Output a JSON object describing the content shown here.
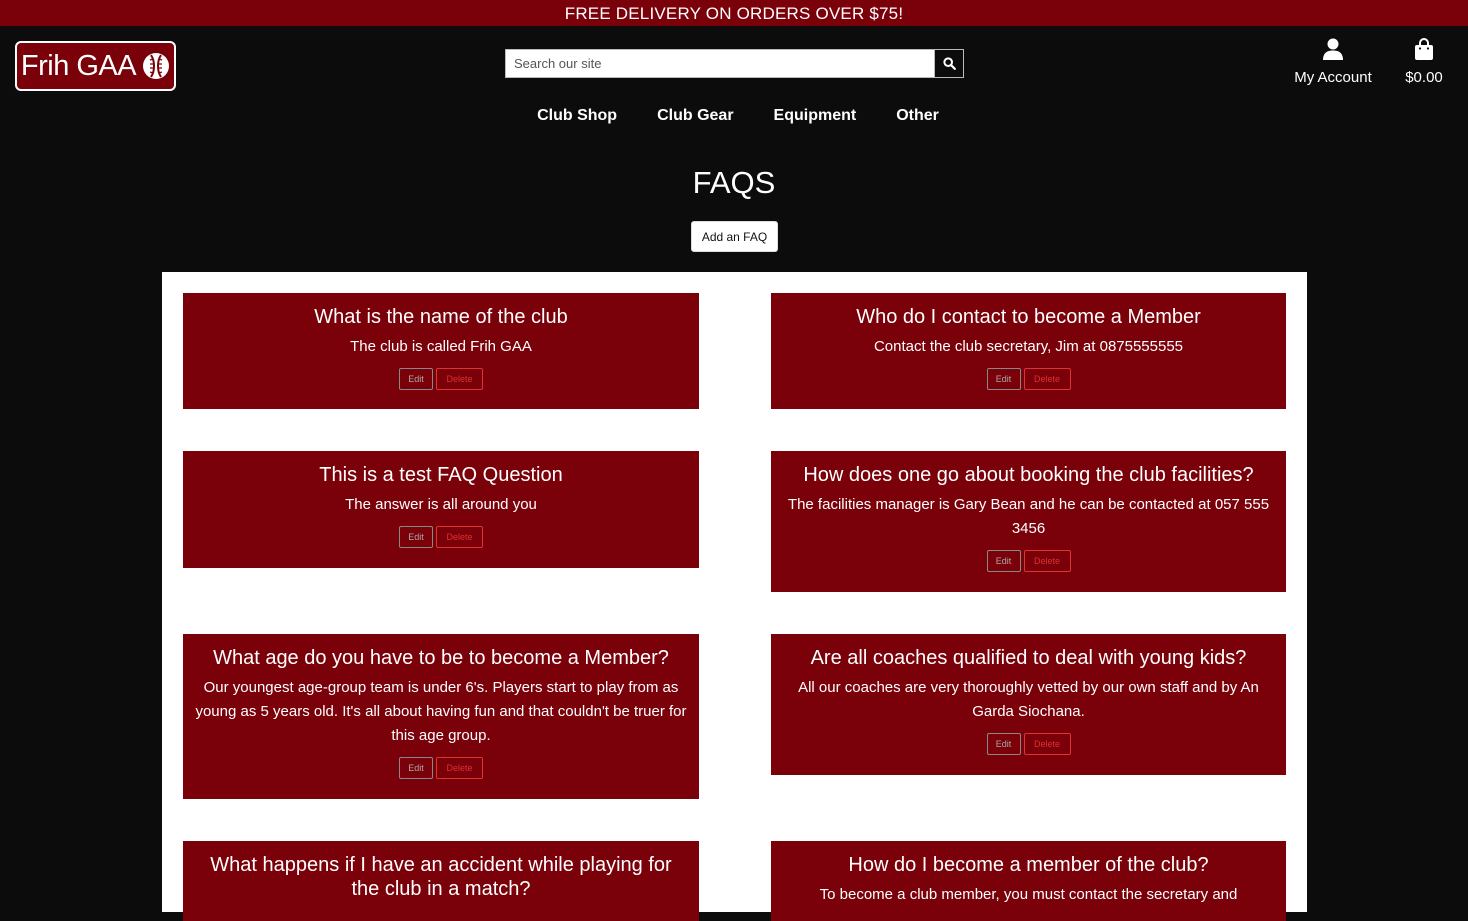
{
  "banner": "FREE DELIVERY ON ORDERS OVER $75!",
  "logo": {
    "text": "Frih GAA",
    "icon": "sliotar-ball-icon"
  },
  "search": {
    "placeholder": "Search our site",
    "icon": "search-icon"
  },
  "header": {
    "account_label": "My Account",
    "account_icon": "user-icon",
    "cart_total": "$0.00",
    "cart_icon": "shopping-bag-icon"
  },
  "nav": [
    "Club Shop",
    "Club Gear",
    "Equipment",
    "Other"
  ],
  "page_title": "FAQS",
  "add_button": "Add an FAQ",
  "edit_label": "Edit",
  "delete_label": "Delete",
  "faqs": [
    {
      "question": "What is the name of the club",
      "answer": "The club is called Frih GAA"
    },
    {
      "question": "Who do I contact to become a Member",
      "answer": "Contact the club secretary, Jim at 0875555555"
    },
    {
      "question": "This is a test FAQ Question",
      "answer": "The answer is all around you"
    },
    {
      "question": "How does one go about booking the club facilities?",
      "answer": "The facilities manager is Gary Bean and he can be contacted at 057 555 3456"
    },
    {
      "question": "What age do you have to be to become a Member?",
      "answer": "Our youngest age-group team is under 6's. Players start to play from as young as 5 years old. It's all about having fun and that couldn't be truer for this age group."
    },
    {
      "question": "Are all coaches qualified to deal with young kids?",
      "answer": "All our coaches are very thoroughly vetted by our own staff and by An Garda Siochana."
    },
    {
      "question": "What happens if I have an accident while playing for the club in a match?",
      "answer": ""
    },
    {
      "question": "How do I become a member of the club?",
      "answer": "To become a club member, you must contact the secretary and"
    }
  ],
  "colors": {
    "brand": "#7a0009",
    "background": "#0c0c0c",
    "panel": "#ffffff"
  }
}
